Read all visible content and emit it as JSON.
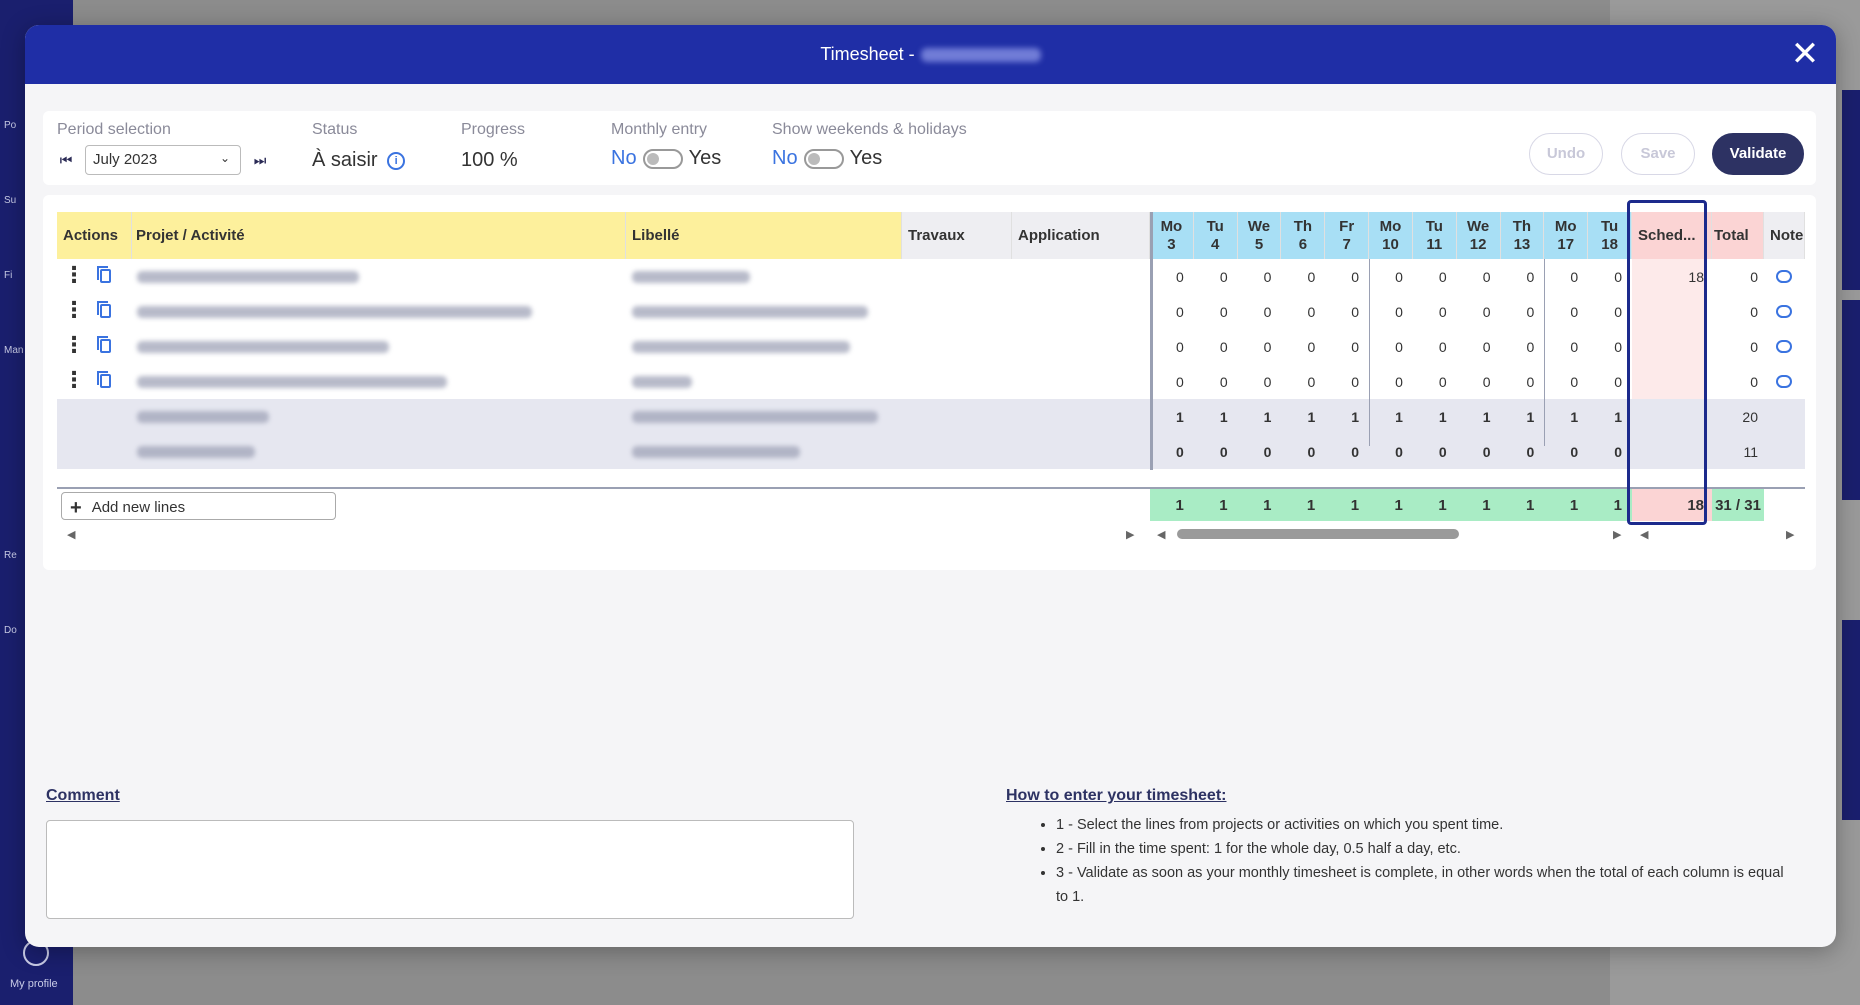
{
  "background": {
    "nav_labels": [
      "Po",
      "Su",
      "Fi",
      "Man",
      "Re",
      "Do"
    ],
    "profile_label": "My profile"
  },
  "modal": {
    "title": "Timesheet -",
    "close_icon": "close-icon"
  },
  "toolbar": {
    "period_label": "Period selection",
    "period_value": "July 2023",
    "status_label": "Status",
    "status_value": "À saisir",
    "progress_label": "Progress",
    "progress_value": "100 %",
    "monthly_label": "Monthly entry",
    "monthly_no": "No",
    "monthly_yes": "Yes",
    "weekends_label": "Show weekends & holidays",
    "weekends_no": "No",
    "weekends_yes": "Yes",
    "undo_label": "Undo",
    "save_label": "Save",
    "validate_label": "Validate"
  },
  "table": {
    "headers": {
      "actions": "Actions",
      "project": "Projet / Activité",
      "libelle": "Libellé",
      "travaux": "Travaux",
      "application": "Application",
      "sched": "Sched...",
      "total": "Total",
      "note": "Note"
    },
    "days": [
      {
        "d": "Mo",
        "n": "3"
      },
      {
        "d": "Tu",
        "n": "4"
      },
      {
        "d": "We",
        "n": "5"
      },
      {
        "d": "Th",
        "n": "6"
      },
      {
        "d": "Fr",
        "n": "7"
      },
      {
        "d": "Mo",
        "n": "10"
      },
      {
        "d": "Tu",
        "n": "11"
      },
      {
        "d": "We",
        "n": "12"
      },
      {
        "d": "Th",
        "n": "13"
      },
      {
        "d": "Mo",
        "n": "17"
      },
      {
        "d": "Tu",
        "n": "18"
      }
    ],
    "rows": [
      {
        "values": [
          "0",
          "0",
          "0",
          "0",
          "0",
          "0",
          "0",
          "0",
          "0",
          "0",
          "0"
        ],
        "sched": "18",
        "total": "0",
        "has_actions": true
      },
      {
        "values": [
          "0",
          "0",
          "0",
          "0",
          "0",
          "0",
          "0",
          "0",
          "0",
          "0",
          "0"
        ],
        "sched": "",
        "total": "0",
        "has_actions": true
      },
      {
        "values": [
          "0",
          "0",
          "0",
          "0",
          "0",
          "0",
          "0",
          "0",
          "0",
          "0",
          "0"
        ],
        "sched": "",
        "total": "0",
        "has_actions": true
      },
      {
        "values": [
          "0",
          "0",
          "0",
          "0",
          "0",
          "0",
          "0",
          "0",
          "0",
          "0",
          "0"
        ],
        "sched": "",
        "total": "0",
        "has_actions": true
      },
      {
        "values": [
          "1",
          "1",
          "1",
          "1",
          "1",
          "1",
          "1",
          "1",
          "1",
          "1",
          "1"
        ],
        "sched": "",
        "total": "20",
        "has_actions": false
      },
      {
        "values": [
          "0",
          "0",
          "0",
          "0",
          "0",
          "0",
          "0",
          "0",
          "0",
          "0",
          "0"
        ],
        "sched": "",
        "total": "11",
        "has_actions": false
      }
    ],
    "totals": {
      "values": [
        "1",
        "1",
        "1",
        "1",
        "1",
        "1",
        "1",
        "1",
        "1",
        "1",
        "1"
      ],
      "sched": "18",
      "total": "31 / 31"
    },
    "add_lines_label": "Add new lines"
  },
  "comment": {
    "label": "Comment"
  },
  "howto": {
    "title": "How to enter your timesheet:",
    "steps": [
      "1 - Select the lines from projects or activities on which you spent time.",
      "2 - Fill in the time spent: 1 for the whole day, 0.5 half a day, etc.",
      "3 - Validate as soon as your monthly timesheet is complete, in other words when the total of each column is equal to 1."
    ]
  }
}
